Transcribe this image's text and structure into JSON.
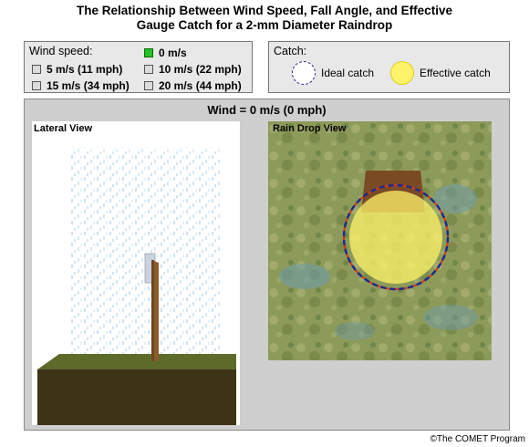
{
  "title": {
    "line1": "The Relationship Between Wind Speed, Fall Angle, and Effective",
    "line2": "Gauge Catch for a 2-mm Diameter Raindrop"
  },
  "wind_speed": {
    "label": "Wind speed:",
    "options": [
      {
        "label": "0 m/s",
        "selected": true
      },
      {
        "label": "5 m/s (11 mph)",
        "selected": false
      },
      {
        "label": "10 m/s (22 mph)",
        "selected": false
      },
      {
        "label": "15 m/s (34 mph)",
        "selected": false
      },
      {
        "label": "20 m/s (44 mph)",
        "selected": false
      }
    ]
  },
  "catch_legend": {
    "label": "Catch:",
    "ideal": "Ideal catch",
    "effective": "Effective catch"
  },
  "main": {
    "wind_label": "Wind = 0 m/s (0 mph)",
    "lateral_title": "Lateral View",
    "dropview_title": "Rain Drop View"
  },
  "credit": "©The COMET Program",
  "colors": {
    "selected_box": "#22c322",
    "ideal_catch": "#22228a",
    "effective_catch": "#fff36a",
    "ground_top": "#5d6b2a",
    "ground_front": "#3d3418",
    "rain": "#7fb2d6",
    "gauge_post": "#8a5a2b"
  }
}
